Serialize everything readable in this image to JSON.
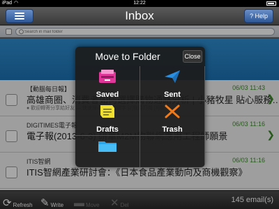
{
  "statusbar": {
    "carrier": "iPad",
    "time": "12:22"
  },
  "navbar": {
    "title": "Inbox",
    "help_label": "Help"
  },
  "search": {
    "placeholder": "Search in mail folder"
  },
  "emails": [
    {
      "sender": "【動腦每日報】",
      "date": "06/03 11:43",
      "subject": "高雄商圈、消費者如何選擇購物通路分析 | 小豬牧星 貼心服務…",
      "preview": "● 歡迎轉寄分享給好友 — 快速搜尋熱門關鍵字 [2]我要訂閱 [3]取…"
    },
    {
      "sender": "DIGITIMES電子報",
      "date": "06/03 11:16",
      "subject": "電子報(2013-6-3) 研華M2M物聯網應用工程師願景",
      "preview": ""
    },
    {
      "sender": "ITIS智網",
      "date": "06/03 11:16",
      "subject": "ITIS智網產業研討會：《日本食品產業動向及商機觀察》",
      "preview": ""
    }
  ],
  "toolbar": {
    "refresh_label": "Refresh",
    "write_label": "Write",
    "move_label": "Move",
    "delete_label": "Del",
    "count_label": "145 email(s)"
  },
  "popup": {
    "title": "Move to Folder",
    "close_label": "Close",
    "folders": [
      {
        "label": "Saved",
        "icon": "inbox-tray-icon"
      },
      {
        "label": "Sent",
        "icon": "paper-plane-icon"
      },
      {
        "label": "Drafts",
        "icon": "sticky-note-icon"
      },
      {
        "label": "Trash",
        "icon": "x-mark-icon"
      },
      {
        "label": "",
        "icon": "folder-icon"
      }
    ]
  },
  "colors": {
    "accent_blue": "#2d5797",
    "band_blue": "#2f8ed0",
    "date_green": "#3b8a2a",
    "saved_pink": "#e0379b",
    "sent_blue": "#2a8fe0",
    "drafts_yellow": "#f2e030",
    "trash_orange": "#f07a1a",
    "folder_blue": "#2aa6e8"
  }
}
